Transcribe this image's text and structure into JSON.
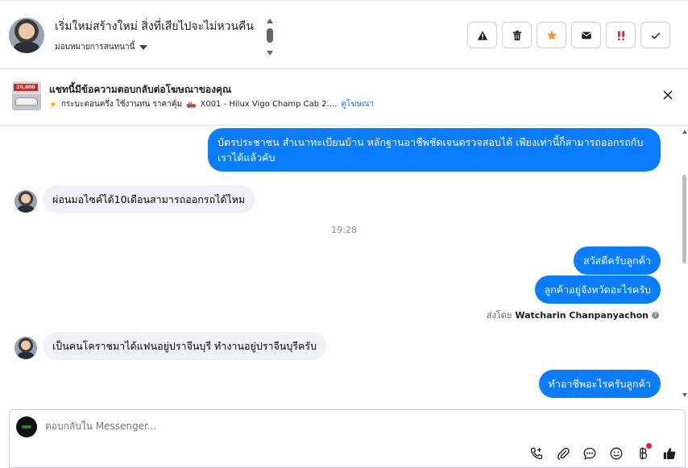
{
  "header": {
    "title": "เริ่มใหม่สร้างใหม่ สิ่งที่เสียไปจะไม่หวนคืน",
    "assign_label": "มอบหมายการสนทนานี้",
    "toolbar": [
      {
        "name": "warning",
        "icon": "warning-icon"
      },
      {
        "name": "delete",
        "icon": "trash-icon"
      },
      {
        "name": "star",
        "icon": "star-icon",
        "color": "#f7923b"
      },
      {
        "name": "mark-unread",
        "icon": "envelope-icon"
      },
      {
        "name": "priority",
        "icon": "exclamation-icon",
        "color": "#e41e3f"
      },
      {
        "name": "done",
        "icon": "check-icon"
      }
    ]
  },
  "ad": {
    "title": "แชทนี้มีข้อความตอบกลับต่อโฆษณาของคุณ",
    "thumb_tag": "20,000",
    "meta_text": "กระบะตอนครึ่ง ใช้งานทน ราคาคุ้ม",
    "meta_product": "X001 - Hilux Vigo Champ Cab 2....",
    "meta_link": "ดูโฆษณา"
  },
  "messages": {
    "m1": "บัตรประชาชน สำเนาทะเบียนบ้าน หลักฐานอาชีพชัดเจนตรวจสอบได้ เพียงเท่านี้ก็สามารถออกรถกับเราได้แล้วคับ",
    "m2": "ผ่อนมอไซค์ได้10เดือนสามารถออกรถได้ไหม",
    "time": "19:28",
    "m3": "สวัสดีครับลูกค้า",
    "m4": "ลูกค้าอยู่จังหวัดอะไรครับ",
    "sent_by_prefix": "ส่งโดย",
    "sent_by_name": "Watcharin Chanpanyachon",
    "m5": "เป็นคนโคราชมาได้แฟนอยู่ปราจีนบุรี ทำงานอยู่ปราจีนบุรีครับ",
    "m6": "ทำอาชีพอะไรครับลูกค้า"
  },
  "composer": {
    "placeholder": "ตอบกลับใน Messenger...",
    "tools": [
      "call-icon",
      "attachment-icon",
      "saved-reply-icon",
      "emoji-icon",
      "payment-icon",
      "like-icon"
    ]
  },
  "colors": {
    "outgoing": "#0a7cff",
    "incoming": "#f0f2f5",
    "link": "#1877f2"
  }
}
